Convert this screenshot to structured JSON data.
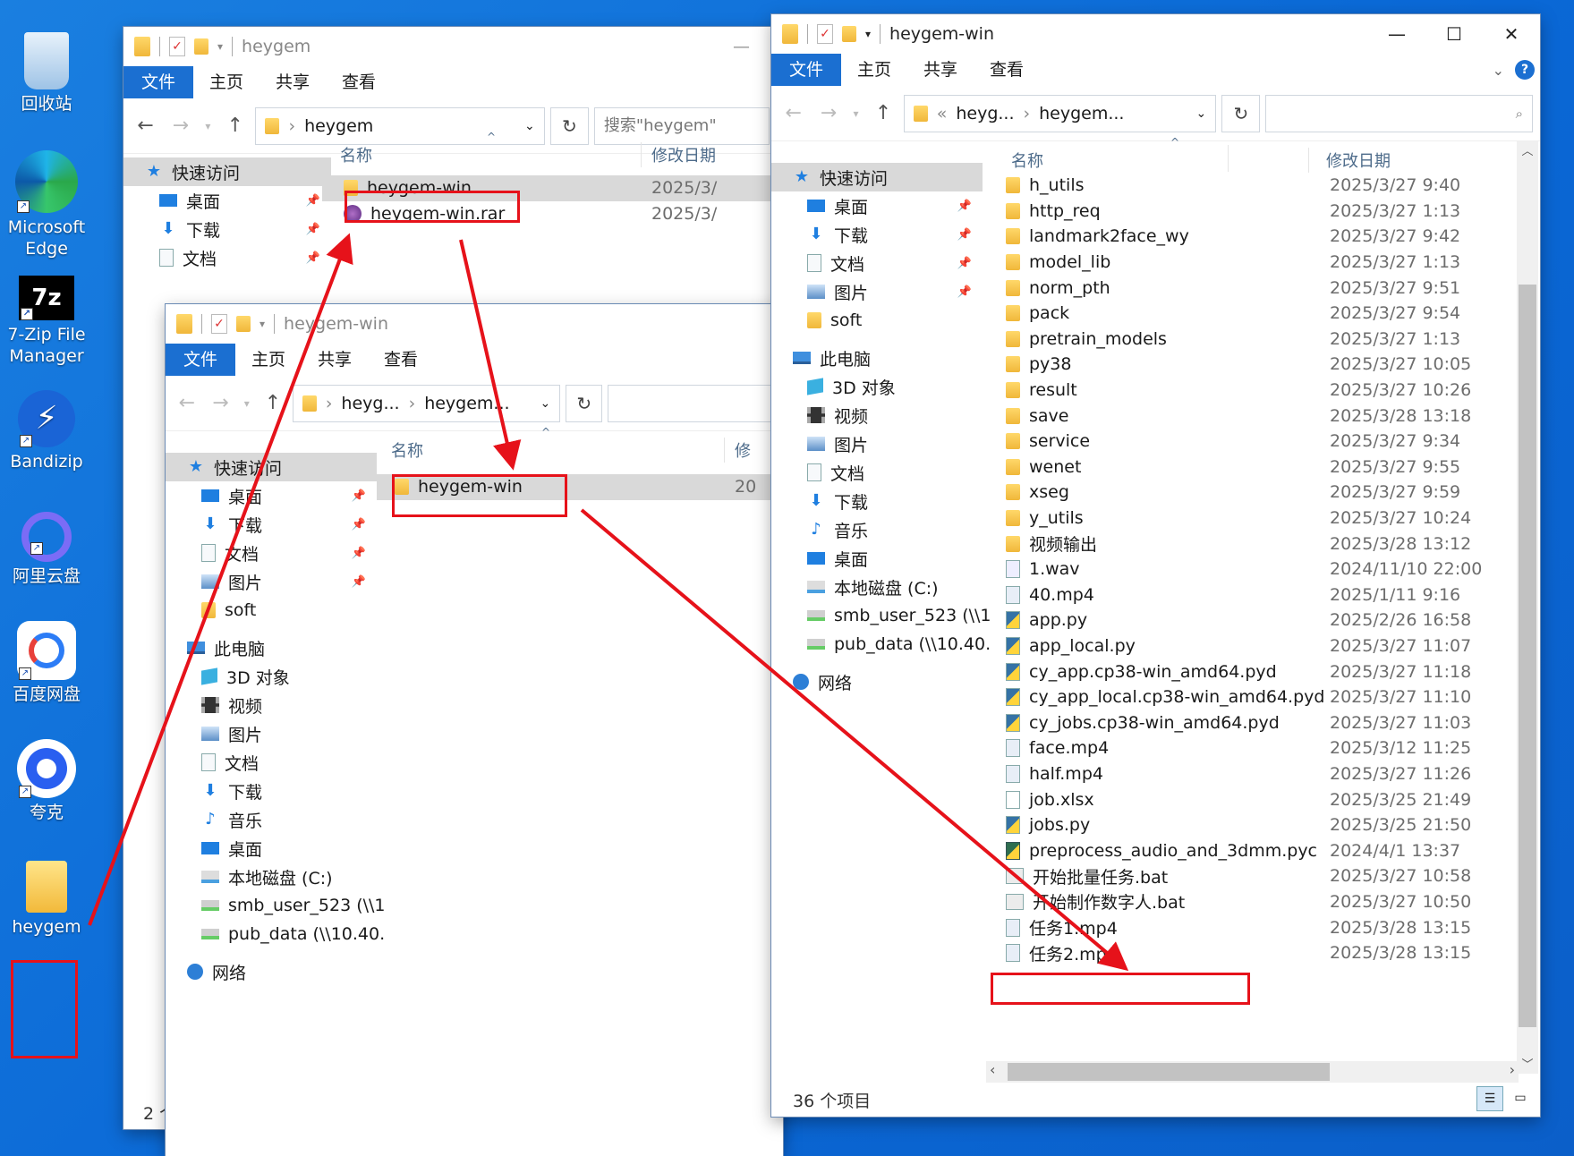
{
  "desktop": {
    "icons": [
      {
        "label": "回收站",
        "icon": "recycle-bin-icon"
      },
      {
        "label": "Microsoft Edge",
        "icon": "edge-icon"
      },
      {
        "label": "7-Zip File Manager",
        "icon": "7zip-icon"
      },
      {
        "label": "Bandizip",
        "icon": "bandizip-icon"
      },
      {
        "label": "阿里云盘",
        "icon": "aliyun-drive-icon"
      },
      {
        "label": "百度网盘",
        "icon": "baidu-netdisk-icon"
      },
      {
        "label": "夸克",
        "icon": "quark-icon"
      },
      {
        "label": "heygem",
        "icon": "folder-icon"
      }
    ]
  },
  "ribbon_tabs": {
    "file": "文件",
    "home": "主页",
    "share": "共享",
    "view": "查看"
  },
  "window1": {
    "title": "heygem",
    "address": "heygem",
    "search_placeholder": "搜索\"heygem\"",
    "col_name": "名称",
    "col_date": "修改日期",
    "nav": [
      {
        "label": "快速访问",
        "icon": "star-icon"
      },
      {
        "label": "桌面",
        "icon": "desktop-icon"
      },
      {
        "label": "下载",
        "icon": "download-icon"
      },
      {
        "label": "文档",
        "icon": "document-icon"
      }
    ],
    "files": [
      {
        "name": "heygem-win",
        "date": "2025/3/"
      },
      {
        "name": "heygem-win.rar",
        "date": "2025/3/"
      }
    ],
    "status": "2 个"
  },
  "window2": {
    "title": "heygem-win",
    "address_parent": "heyg...",
    "address_current": "heygem...",
    "col_name": "名称",
    "col_date": "修",
    "nav": [
      {
        "label": "快速访问",
        "icon": "star-icon",
        "type": "hd"
      },
      {
        "label": "桌面",
        "icon": "desktop-icon",
        "pin": true
      },
      {
        "label": "下载",
        "icon": "download-icon",
        "pin": true
      },
      {
        "label": "文档",
        "icon": "document-icon",
        "pin": true
      },
      {
        "label": "图片",
        "icon": "pictures-icon",
        "pin": true
      },
      {
        "label": "soft",
        "icon": "folder-icon"
      },
      {
        "label": "此电脑",
        "icon": "this-pc-icon",
        "type": "top"
      },
      {
        "label": "3D 对象",
        "icon": "3d-objects-icon"
      },
      {
        "label": "视频",
        "icon": "videos-icon"
      },
      {
        "label": "图片",
        "icon": "pictures-icon"
      },
      {
        "label": "文档",
        "icon": "document-icon"
      },
      {
        "label": "下载",
        "icon": "download-icon"
      },
      {
        "label": "音乐",
        "icon": "music-icon"
      },
      {
        "label": "桌面",
        "icon": "desktop-icon"
      },
      {
        "label": "本地磁盘 (C:)",
        "icon": "local-disk-icon"
      },
      {
        "label": "smb_user_523 (\\\\1",
        "icon": "network-drive-icon"
      },
      {
        "label": "pub_data (\\\\10.40.",
        "icon": "network-drive-icon"
      },
      {
        "label": "网络",
        "icon": "network-icon",
        "type": "top"
      }
    ],
    "files": [
      {
        "name": "heygem-win",
        "date": "20"
      }
    ]
  },
  "window3": {
    "title": "heygem-win",
    "address_prefix": "«",
    "address_parent": "heyg...",
    "address_current": "heygem...",
    "col_name": "名称",
    "col_date": "修改日期",
    "nav": [
      {
        "label": "快速访问",
        "icon": "star-icon",
        "type": "hd"
      },
      {
        "label": "桌面",
        "icon": "desktop-icon",
        "pin": true
      },
      {
        "label": "下载",
        "icon": "download-icon",
        "pin": true
      },
      {
        "label": "文档",
        "icon": "document-icon",
        "pin": true
      },
      {
        "label": "图片",
        "icon": "pictures-icon",
        "pin": true
      },
      {
        "label": "soft",
        "icon": "folder-icon"
      },
      {
        "label": "此电脑",
        "icon": "this-pc-icon",
        "type": "top"
      },
      {
        "label": "3D 对象",
        "icon": "3d-objects-icon"
      },
      {
        "label": "视频",
        "icon": "videos-icon"
      },
      {
        "label": "图片",
        "icon": "pictures-icon"
      },
      {
        "label": "文档",
        "icon": "document-icon"
      },
      {
        "label": "下载",
        "icon": "download-icon"
      },
      {
        "label": "音乐",
        "icon": "music-icon"
      },
      {
        "label": "桌面",
        "icon": "desktop-icon"
      },
      {
        "label": "本地磁盘 (C:)",
        "icon": "local-disk-icon"
      },
      {
        "label": "smb_user_523 (\\\\1",
        "icon": "network-drive-icon"
      },
      {
        "label": "pub_data (\\\\10.40.",
        "icon": "network-drive-icon"
      },
      {
        "label": "网络",
        "icon": "network-icon",
        "type": "top"
      }
    ],
    "files": [
      {
        "name": "h_utils",
        "date": "2025/3/27 9:40",
        "icon": "folder-icon"
      },
      {
        "name": "http_req",
        "date": "2025/3/27 1:13",
        "icon": "folder-icon"
      },
      {
        "name": "landmark2face_wy",
        "date": "2025/3/27 9:42",
        "icon": "folder-icon"
      },
      {
        "name": "model_lib",
        "date": "2025/3/27 1:13",
        "icon": "folder-icon"
      },
      {
        "name": "norm_pth",
        "date": "2025/3/27 9:51",
        "icon": "folder-icon"
      },
      {
        "name": "pack",
        "date": "2025/3/27 9:54",
        "icon": "folder-icon"
      },
      {
        "name": "pretrain_models",
        "date": "2025/3/27 1:13",
        "icon": "folder-icon"
      },
      {
        "name": "py38",
        "date": "2025/3/27 10:05",
        "icon": "folder-icon"
      },
      {
        "name": "result",
        "date": "2025/3/27 10:26",
        "icon": "folder-icon"
      },
      {
        "name": "save",
        "date": "2025/3/28 13:18",
        "icon": "folder-icon"
      },
      {
        "name": "service",
        "date": "2025/3/27 9:34",
        "icon": "folder-icon"
      },
      {
        "name": "wenet",
        "date": "2025/3/27 9:55",
        "icon": "folder-icon"
      },
      {
        "name": "xseg",
        "date": "2025/3/27 9:59",
        "icon": "folder-icon"
      },
      {
        "name": "y_utils",
        "date": "2025/3/27 10:24",
        "icon": "folder-icon"
      },
      {
        "name": "视频输出",
        "date": "2025/3/28 13:12",
        "icon": "folder-icon"
      },
      {
        "name": "1.wav",
        "date": "2024/11/10 22:00",
        "icon": "audio-file-icon"
      },
      {
        "name": "40.mp4",
        "date": "2025/1/11 9:16",
        "icon": "video-file-icon"
      },
      {
        "name": "app.py",
        "date": "2025/2/26 16:58",
        "icon": "python-file-icon"
      },
      {
        "name": "app_local.py",
        "date": "2025/3/27 11:07",
        "icon": "python-file-icon"
      },
      {
        "name": "cy_app.cp38-win_amd64.pyd",
        "date": "2025/3/27 11:18",
        "icon": "python-file-icon"
      },
      {
        "name": "cy_app_local.cp38-win_amd64.pyd",
        "date": "2025/3/27 11:10",
        "icon": "python-file-icon"
      },
      {
        "name": "cy_jobs.cp38-win_amd64.pyd",
        "date": "2025/3/27 11:03",
        "icon": "python-file-icon"
      },
      {
        "name": "face.mp4",
        "date": "2025/3/12 11:25",
        "icon": "video-file-icon"
      },
      {
        "name": "half.mp4",
        "date": "2025/3/27 11:26",
        "icon": "video-file-icon"
      },
      {
        "name": "job.xlsx",
        "date": "2025/3/25 21:49",
        "icon": "excel-file-icon"
      },
      {
        "name": "jobs.py",
        "date": "2025/3/25 21:50",
        "icon": "python-file-icon"
      },
      {
        "name": "preprocess_audio_and_3dmm.pyc",
        "date": "2024/4/1 13:37",
        "icon": "pyc-file-icon"
      },
      {
        "name": "开始批量任务.bat",
        "date": "2025/3/27 10:58",
        "icon": "batch-file-icon"
      },
      {
        "name": "开始制作数字人.bat",
        "date": "2025/3/27 10:50",
        "icon": "batch-file-icon"
      },
      {
        "name": "任务1.mp4",
        "date": "2025/3/28 13:15",
        "icon": "video-file-icon"
      },
      {
        "name": "任务2.mp4",
        "date": "2025/3/28 13:15",
        "icon": "video-file-icon"
      }
    ],
    "status": "36 个项目"
  },
  "colors": {
    "annotation": "#e6121a",
    "ribbon_file": "#1b6fd1",
    "desktop": "#0a68d6"
  }
}
